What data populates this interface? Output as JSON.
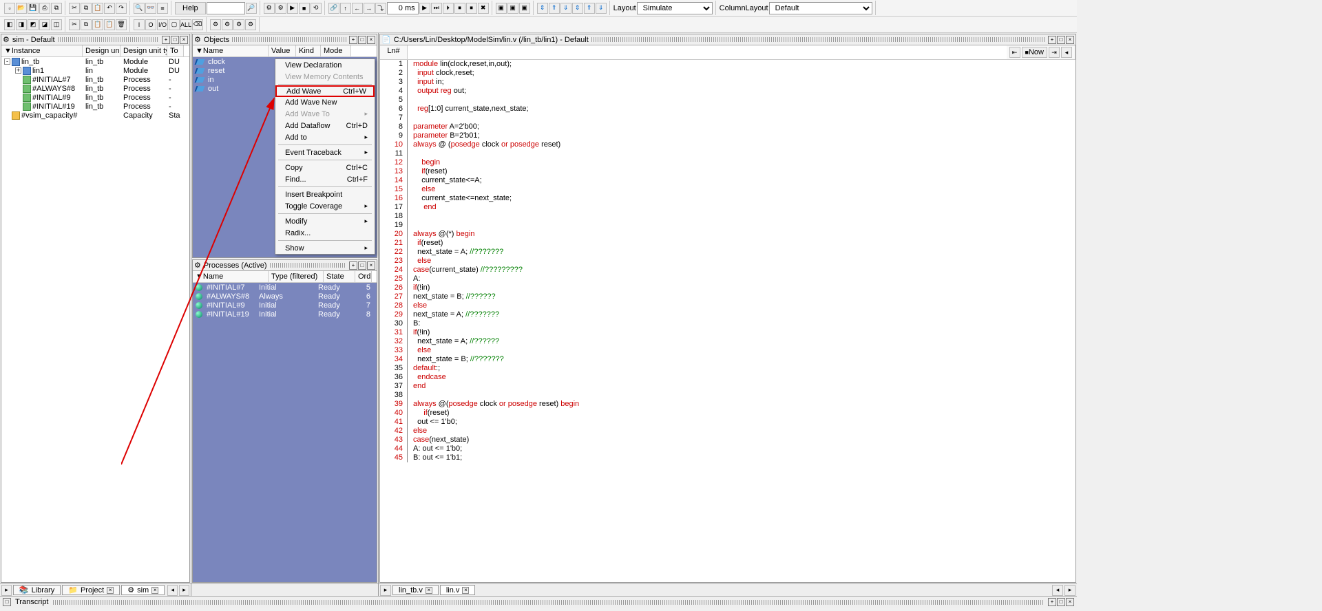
{
  "toolbar": {
    "help": "Help",
    "ms_val": "0 ms",
    "layout_label": "Layout",
    "layout_sel": "Simulate",
    "column_label": "ColumnLayout",
    "column_sel": "Default"
  },
  "sim": {
    "title": "sim - Default",
    "cols": [
      "Instance",
      "Design unit",
      "Design unit type",
      "To"
    ],
    "rows": [
      {
        "indent": 0,
        "exp": "-",
        "icon": "icon-module",
        "name": "lin_tb",
        "du": "lin_tb",
        "dut": "Module",
        "to": "DU"
      },
      {
        "indent": 1,
        "exp": "+",
        "icon": "icon-module",
        "name": "lin1",
        "du": "lin",
        "dut": "Module",
        "to": "DU"
      },
      {
        "indent": 1,
        "exp": "",
        "icon": "icon-process",
        "name": "#INITIAL#7",
        "du": "lin_tb",
        "dut": "Process",
        "to": "-"
      },
      {
        "indent": 1,
        "exp": "",
        "icon": "icon-process",
        "name": "#ALWAYS#8",
        "du": "lin_tb",
        "dut": "Process",
        "to": "-"
      },
      {
        "indent": 1,
        "exp": "",
        "icon": "icon-process",
        "name": "#INITIAL#9",
        "du": "lin_tb",
        "dut": "Process",
        "to": "-"
      },
      {
        "indent": 1,
        "exp": "",
        "icon": "icon-process",
        "name": "#INITIAL#19",
        "du": "lin_tb",
        "dut": "Process",
        "to": "-"
      },
      {
        "indent": 0,
        "exp": "",
        "icon": "icon-cap",
        "name": "#vsim_capacity#",
        "du": "",
        "dut": "Capacity",
        "to": "Sta"
      }
    ],
    "tabs": [
      "Library",
      "Project",
      "sim"
    ]
  },
  "objects": {
    "title": "Objects",
    "cols": [
      "Name",
      "Value",
      "Kind",
      "Mode"
    ],
    "items": [
      "clock",
      "reset",
      "in",
      "out"
    ]
  },
  "processes": {
    "title": "Processes (Active)",
    "cols": [
      "Name",
      "Type (filtered)",
      "State",
      "Ord"
    ],
    "rows": [
      {
        "name": "#INITIAL#7",
        "type": "Initial",
        "state": "Ready",
        "ord": "5"
      },
      {
        "name": "#ALWAYS#8",
        "type": "Always",
        "state": "Ready",
        "ord": "6"
      },
      {
        "name": "#INITIAL#9",
        "type": "Initial",
        "state": "Ready",
        "ord": "7"
      },
      {
        "name": "#INITIAL#19",
        "type": "Initial",
        "state": "Ready",
        "ord": "8"
      }
    ]
  },
  "code": {
    "path": "C:/Users/Lin/Desktop/ModelSim/lin.v (/lin_tb/lin1) - Default",
    "ln": "Ln#",
    "now": "Now",
    "tabs": [
      "lin_tb.v",
      "lin.v"
    ],
    "lines": [
      {
        "n": 1,
        "r": 0,
        "html": "<span class='kw'>module</span> lin(clock,reset,in,out);"
      },
      {
        "n": 2,
        "r": 0,
        "html": "  <span class='kw'>input</span> clock,reset;"
      },
      {
        "n": 3,
        "r": 0,
        "html": "  <span class='kw'>input</span> in;"
      },
      {
        "n": 4,
        "r": 0,
        "html": "  <span class='kw'>output reg</span> out;"
      },
      {
        "n": 5,
        "r": 0,
        "html": ""
      },
      {
        "n": 6,
        "r": 0,
        "html": "  <span class='kw'>reg</span>[1:0] current_state,next_state;"
      },
      {
        "n": 7,
        "r": 0,
        "html": ""
      },
      {
        "n": 8,
        "r": 0,
        "html": "<span class='kw'>parameter</span> A=2'b00;"
      },
      {
        "n": 9,
        "r": 0,
        "html": "<span class='kw'>parameter</span> B=2'b01;"
      },
      {
        "n": 10,
        "r": 1,
        "html": "<span class='kw'>always</span> @ (<span class='kw'>posedge</span> clock <span class='kw'>or</span> <span class='kw'>posedge</span> reset)"
      },
      {
        "n": 11,
        "r": 0,
        "html": ""
      },
      {
        "n": 12,
        "r": 1,
        "html": "    <span class='kw'>begin</span>"
      },
      {
        "n": 13,
        "r": 1,
        "html": "    <span class='kw'>if</span>(reset)"
      },
      {
        "n": 14,
        "r": 1,
        "html": "    current_state&lt;=A;"
      },
      {
        "n": 15,
        "r": 1,
        "html": "    <span class='kw'>else</span>"
      },
      {
        "n": 16,
        "r": 1,
        "html": "    current_state&lt;=next_state;"
      },
      {
        "n": 17,
        "r": 0,
        "html": "     <span class='kw'>end</span>"
      },
      {
        "n": 18,
        "r": 0,
        "html": ""
      },
      {
        "n": 19,
        "r": 0,
        "html": ""
      },
      {
        "n": 20,
        "r": 1,
        "html": "<span class='kw'>always</span> @(*) <span class='kw'>begin</span>"
      },
      {
        "n": 21,
        "r": 1,
        "html": "  <span class='kw'>if</span>(reset)"
      },
      {
        "n": 22,
        "r": 1,
        "html": "  next_state = A; <span class='cm'>//???????</span>"
      },
      {
        "n": 23,
        "r": 1,
        "html": "  <span class='kw'>else</span>"
      },
      {
        "n": 24,
        "r": 1,
        "html": "<span class='kw'>case</span>(current_state) <span class='cm'>//?????????</span>"
      },
      {
        "n": 25,
        "r": 1,
        "html": "A:"
      },
      {
        "n": 26,
        "r": 1,
        "html": "<span class='kw'>if</span>(!in)"
      },
      {
        "n": 27,
        "r": 1,
        "html": "next_state = B; <span class='cm'>//??????</span>"
      },
      {
        "n": 28,
        "r": 1,
        "html": "<span class='kw'>else</span>"
      },
      {
        "n": 29,
        "r": 1,
        "html": "next_state = A; <span class='cm'>//???????</span>"
      },
      {
        "n": 30,
        "r": 0,
        "html": "B:"
      },
      {
        "n": 31,
        "r": 1,
        "html": "<span class='kw'>if</span>(!in)"
      },
      {
        "n": 32,
        "r": 1,
        "html": "  next_state = A; <span class='cm'>//??????</span>"
      },
      {
        "n": 33,
        "r": 1,
        "html": "  <span class='kw'>else</span>"
      },
      {
        "n": 34,
        "r": 1,
        "html": "  next_state = B; <span class='cm'>//???????</span>"
      },
      {
        "n": 35,
        "r": 0,
        "html": "<span class='kw'>default</span>:;"
      },
      {
        "n": 36,
        "r": 0,
        "html": "  <span class='kw'>endcase</span>"
      },
      {
        "n": 37,
        "r": 0,
        "html": "<span class='kw'>end</span>"
      },
      {
        "n": 38,
        "r": 0,
        "html": ""
      },
      {
        "n": 39,
        "r": 1,
        "html": "<span class='kw'>always</span> @(<span class='kw'>posedge</span> clock <span class='kw'>or</span> <span class='kw'>posedge</span> reset) <span class='kw'>begin</span>"
      },
      {
        "n": 40,
        "r": 1,
        "html": "     <span class='kw'>if</span>(reset)"
      },
      {
        "n": 41,
        "r": 1,
        "html": "  out &lt;= 1'b0;"
      },
      {
        "n": 42,
        "r": 1,
        "html": "<span class='kw'>else</span>"
      },
      {
        "n": 43,
        "r": 1,
        "html": "<span class='kw'>case</span>(next_state)"
      },
      {
        "n": 44,
        "r": 1,
        "html": "A: out &lt;= 1'b0;"
      },
      {
        "n": 45,
        "r": 1,
        "html": "B: out &lt;= 1'b1;"
      }
    ]
  },
  "menu": {
    "items": [
      {
        "label": "View Declaration",
        "sc": "",
        "sub": false,
        "dis": false
      },
      {
        "label": "View Memory Contents",
        "sc": "",
        "sub": false,
        "dis": true
      },
      {
        "sep": true
      },
      {
        "label": "Add Wave",
        "sc": "Ctrl+W",
        "sub": false,
        "dis": false,
        "boxed": true
      },
      {
        "label": "Add Wave New",
        "sc": "",
        "sub": false,
        "dis": false
      },
      {
        "label": "Add Wave To",
        "sc": "",
        "sub": true,
        "dis": true
      },
      {
        "label": "Add Dataflow",
        "sc": "Ctrl+D",
        "sub": false,
        "dis": false
      },
      {
        "label": "Add to",
        "sc": "",
        "sub": true,
        "dis": false
      },
      {
        "sep": true
      },
      {
        "label": "Event Traceback",
        "sc": "",
        "sub": true,
        "dis": false
      },
      {
        "sep": true
      },
      {
        "label": "Copy",
        "sc": "Ctrl+C",
        "sub": false,
        "dis": false
      },
      {
        "label": "Find...",
        "sc": "Ctrl+F",
        "sub": false,
        "dis": false
      },
      {
        "sep": true
      },
      {
        "label": "Insert Breakpoint",
        "sc": "",
        "sub": false,
        "dis": false
      },
      {
        "label": "Toggle Coverage",
        "sc": "",
        "sub": true,
        "dis": false
      },
      {
        "sep": true
      },
      {
        "label": "Modify",
        "sc": "",
        "sub": true,
        "dis": false
      },
      {
        "label": "Radix...",
        "sc": "",
        "sub": false,
        "dis": false
      },
      {
        "sep": true
      },
      {
        "label": "Show",
        "sc": "",
        "sub": true,
        "dis": false
      }
    ]
  },
  "transcript": "Transcript"
}
